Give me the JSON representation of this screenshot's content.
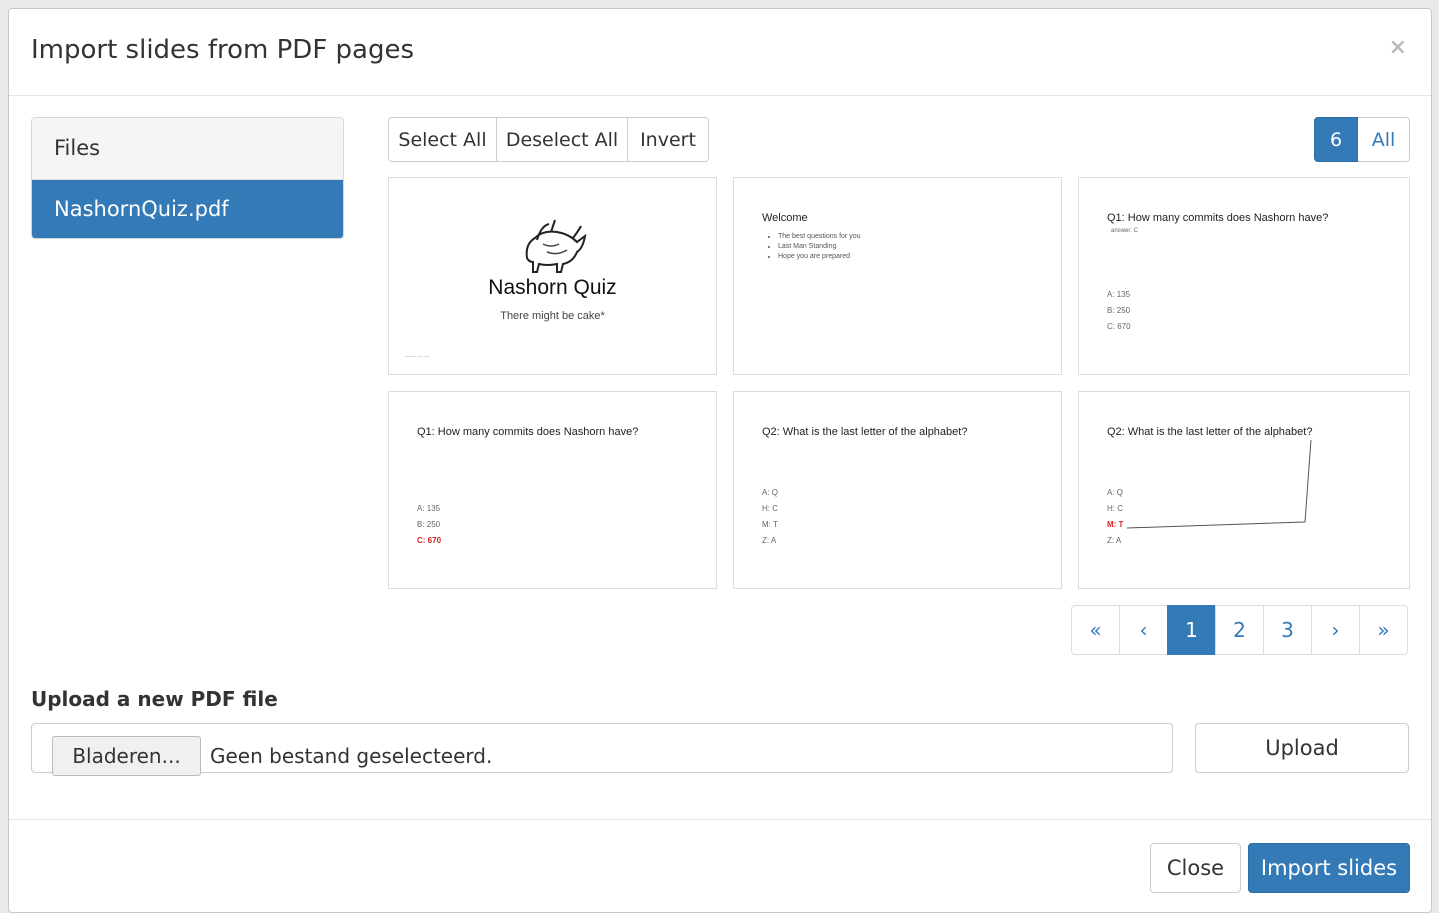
{
  "modal": {
    "title": "Import slides from PDF pages",
    "close_glyph": "×"
  },
  "files": {
    "heading": "Files",
    "items": [
      "NashornQuiz.pdf"
    ]
  },
  "selection": {
    "select_all": "Select All",
    "deselect_all": "Deselect All",
    "invert": "Invert"
  },
  "page_size": {
    "current": "6",
    "all": "All"
  },
  "slides": [
    {
      "title": "Nashorn Quiz",
      "subtitle": "There might be cake*",
      "footnote": "— — — —"
    },
    {
      "title": "Welcome",
      "bullets": [
        "The best questions for you",
        "Last Man Standing",
        "Hope you are prepared"
      ]
    },
    {
      "title": "Q1: How many commits does Nashorn have?",
      "note": "answer: C",
      "answers": [
        "A: 135",
        "B: 250",
        "C: 670"
      ]
    },
    {
      "title": "Q1: How many commits does Nashorn have?",
      "answers": [
        "A: 135",
        "B: 250",
        "C: 670"
      ]
    },
    {
      "title": "Q2: What is the last letter of the alphabet?",
      "answers": [
        "A: Q",
        "H: C",
        "M: T",
        "Z: A"
      ]
    },
    {
      "title": "Q2: What is the last letter of the alphabet?",
      "answers": [
        "A: Q",
        "H: C",
        "M: T",
        "Z: A"
      ]
    }
  ],
  "pagination": {
    "first": "«",
    "prev": "‹",
    "pages": [
      "1",
      "2",
      "3"
    ],
    "next": "›",
    "last": "»",
    "active_page": "1"
  },
  "upload": {
    "label": "Upload a new PDF file",
    "browse_label": "Bladeren...",
    "no_file_text": "Geen bestand geselecteerd.",
    "upload_label": "Upload"
  },
  "footer": {
    "close_label": "Close",
    "import_label": "Import slides"
  },
  "colors": {
    "primary": "#337ab7",
    "answer_highlight": "#e02020"
  }
}
